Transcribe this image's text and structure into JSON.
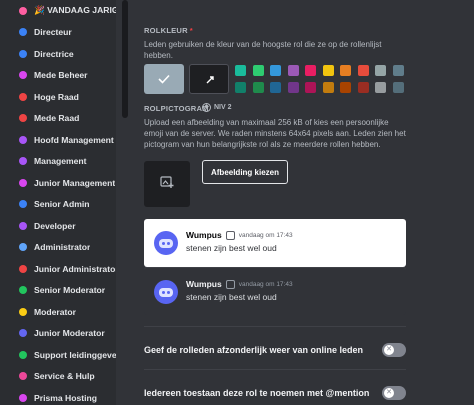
{
  "sidebar": {
    "roles": [
      {
        "label": "🎉 VANDAAG JARIG!",
        "color": "#ff5fa2"
      },
      {
        "label": "Directeur",
        "color": "#3b82f6"
      },
      {
        "label": "Directrice",
        "color": "#3b82f6"
      },
      {
        "label": "Mede Beheer",
        "color": "#d946ef"
      },
      {
        "label": "Hoge Raad",
        "color": "#ef4444"
      },
      {
        "label": "Mede Raad",
        "color": "#ef4444"
      },
      {
        "label": "Hoofd Management",
        "color": "#a855f7"
      },
      {
        "label": "Management",
        "color": "#a855f7"
      },
      {
        "label": "Junior Management",
        "color": "#d946ef"
      },
      {
        "label": "Senior Admin",
        "color": "#3b82f6"
      },
      {
        "label": "Developer",
        "color": "#a855f7"
      },
      {
        "label": "Administrator",
        "color": "#60a5fa"
      },
      {
        "label": "Junior Administrator",
        "color": "#ef4444"
      },
      {
        "label": "Senior Moderator",
        "color": "#22c55e"
      },
      {
        "label": "Moderator",
        "color": "#facc15"
      },
      {
        "label": "Junior Moderator",
        "color": "#6366f1"
      },
      {
        "label": "Support leidinggeve...",
        "color": "#22c55e"
      },
      {
        "label": "Service & Hulp",
        "color": "#ec4899"
      },
      {
        "label": "Prisma Hosting",
        "color": "#d946ef"
      }
    ]
  },
  "color_section": {
    "title": "ROLKLEUR",
    "required_mark": "*",
    "description": "Leden gebruiken de kleur van de hoogste rol die ze op de rollenlijst hebben.",
    "default_color": "#99aab5",
    "check_icon": "check-icon",
    "custom_picker_icon": "eyedropper-icon",
    "swatches_row1": [
      "#1abc9c",
      "#2ecc71",
      "#3498db",
      "#9b59b6",
      "#e91e63",
      "#f1c40f",
      "#e67e22",
      "#e74c3c",
      "#95a5a6",
      "#607d8b"
    ],
    "swatches_row2": [
      "#11806a",
      "#1f8b4c",
      "#206694",
      "#71368a",
      "#ad1457",
      "#c27c0e",
      "#a84300",
      "#992d22",
      "#979c9f",
      "#546e7a"
    ]
  },
  "icon_section": {
    "title": "ROLPICTOGRAM",
    "badge": "NIV 2",
    "description": "Upload een afbeelding van maximaal 256 kB of kies een persoonlijke emoji van de server. We raden minstens 64x64 pixels aan. Leden zien het pictogram van hun belangrijkste rol als ze meerdere rollen hebben.",
    "upload_icon": "image-plus-icon",
    "choose_button": "Afbeelding kiezen"
  },
  "preview": {
    "messages": [
      {
        "name": "Wumpus",
        "time": "vandaag om 17:43",
        "text": "stenen zijn best wel oud",
        "theme": "light"
      },
      {
        "name": "Wumpus",
        "time": "vandaag om 17:43",
        "text": "stenen zijn best wel oud",
        "theme": "dark"
      }
    ]
  },
  "toggles": [
    {
      "label": "Geef de rolleden afzonderlijk weer van online leden",
      "enabled": false
    },
    {
      "label": "Iedereen toestaan deze rol te noemen met @mention",
      "enabled": false
    }
  ]
}
